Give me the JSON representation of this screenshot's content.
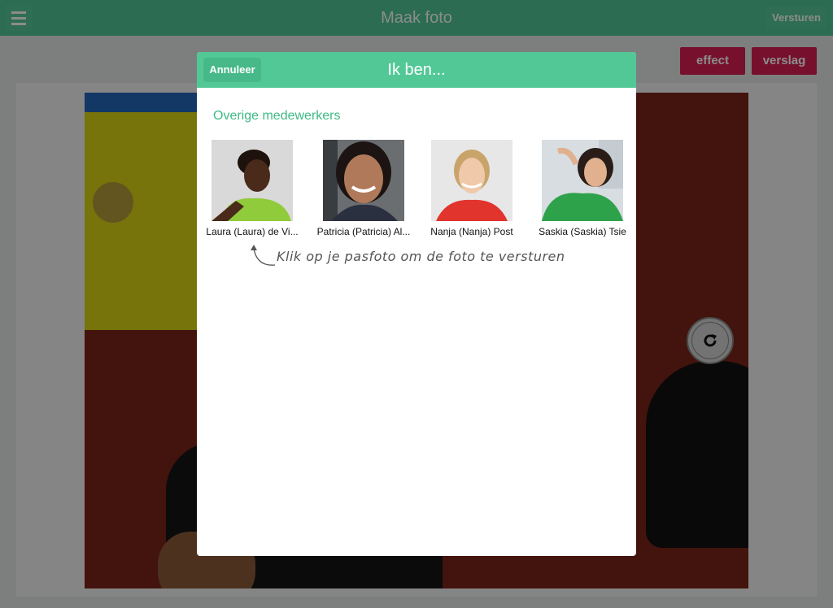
{
  "app": {
    "title": "Maak foto",
    "send_label": "Versturen",
    "effect_label": "effect",
    "report_label": "verslag"
  },
  "modal": {
    "title": "Ik ben...",
    "cancel_label": "Annuleer",
    "section_title": "Overige medewerkers",
    "staff": [
      {
        "name": "Laura (Laura) de Vi..."
      },
      {
        "name": "Patricia (Patricia) Al..."
      },
      {
        "name": "Nanja (Nanja) Post"
      },
      {
        "name": "Saskia (Saskia) Tsie"
      }
    ],
    "hint": "Klik op je pasfoto om de foto te versturen"
  },
  "colors": {
    "header_green": "#52c897",
    "accent_pink": "#d81e52",
    "section_green": "#3dba84"
  },
  "icons": [
    "hamburger-menu-icon",
    "rotate-camera-icon",
    "curved-arrow-icon"
  ]
}
